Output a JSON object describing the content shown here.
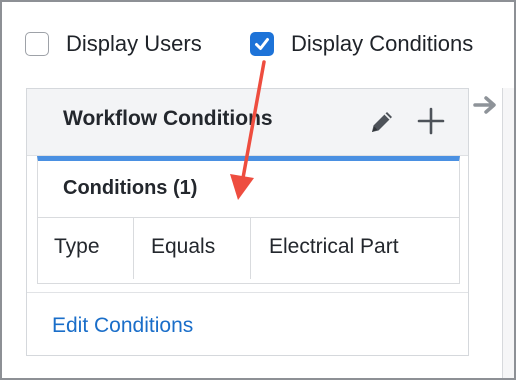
{
  "filters": {
    "display_users": {
      "label": "Display Users",
      "checked": false
    },
    "display_conditions": {
      "label": "Display Conditions",
      "checked": true
    }
  },
  "panel": {
    "title": "Workflow Conditions",
    "icons": [
      "pencil-icon",
      "plus-icon",
      "arrow-right-icon"
    ],
    "conditions": {
      "header": "Conditions (1)",
      "rows": [
        {
          "type": "Type",
          "operator": "Equals",
          "value": "Electrical Part"
        }
      ]
    },
    "edit_link": "Edit Conditions"
  },
  "colors": {
    "accent": "#1d73d8",
    "link": "#1a6ec9",
    "card_top_border": "#4a90e2",
    "annotation_arrow": "#ee4d3f"
  }
}
